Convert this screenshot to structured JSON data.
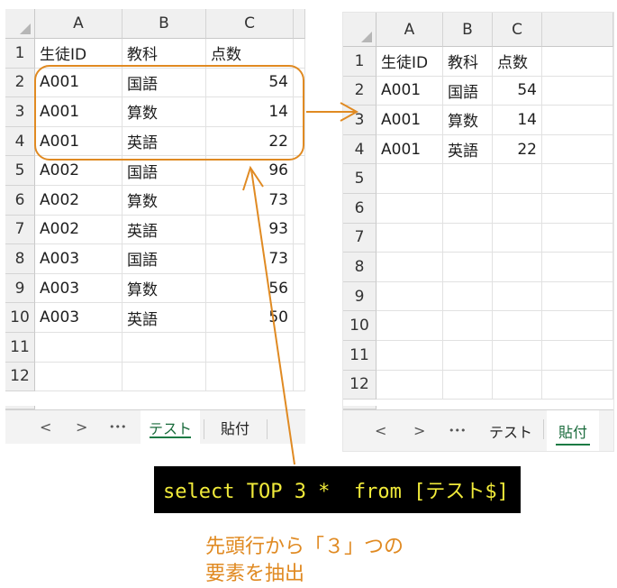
{
  "left_sheet": {
    "columns": [
      "A",
      "B",
      "C"
    ],
    "rows": [
      {
        "n": "1",
        "a": "生徒ID",
        "b": "教科",
        "c": "点数"
      },
      {
        "n": "2",
        "a": "A001",
        "b": "国語",
        "c": "54"
      },
      {
        "n": "3",
        "a": "A001",
        "b": "算数",
        "c": "14"
      },
      {
        "n": "4",
        "a": "A001",
        "b": "英語",
        "c": "22"
      },
      {
        "n": "5",
        "a": "A002",
        "b": "国語",
        "c": "96"
      },
      {
        "n": "6",
        "a": "A002",
        "b": "算数",
        "c": "73"
      },
      {
        "n": "7",
        "a": "A002",
        "b": "英語",
        "c": "93"
      },
      {
        "n": "8",
        "a": "A003",
        "b": "国語",
        "c": "73"
      },
      {
        "n": "9",
        "a": "A003",
        "b": "算数",
        "c": "56"
      },
      {
        "n": "10",
        "a": "A003",
        "b": "英語",
        "c": "50"
      },
      {
        "n": "11",
        "a": "",
        "b": "",
        "c": ""
      },
      {
        "n": "12",
        "a": "",
        "b": "",
        "c": ""
      }
    ],
    "tabs": {
      "prev": "<",
      "next": ">",
      "more": "•••",
      "sheets": [
        "テスト",
        "貼付"
      ],
      "active": "テスト"
    }
  },
  "right_sheet": {
    "columns": [
      "A",
      "B",
      "C"
    ],
    "rows": [
      {
        "n": "1",
        "a": "生徒ID",
        "b": "教科",
        "c": "点数"
      },
      {
        "n": "2",
        "a": "A001",
        "b": "国語",
        "c": "54"
      },
      {
        "n": "3",
        "a": "A001",
        "b": "算数",
        "c": "14"
      },
      {
        "n": "4",
        "a": "A001",
        "b": "英語",
        "c": "22"
      },
      {
        "n": "5",
        "a": "",
        "b": "",
        "c": ""
      },
      {
        "n": "6",
        "a": "",
        "b": "",
        "c": ""
      },
      {
        "n": "7",
        "a": "",
        "b": "",
        "c": ""
      },
      {
        "n": "8",
        "a": "",
        "b": "",
        "c": ""
      },
      {
        "n": "9",
        "a": "",
        "b": "",
        "c": ""
      },
      {
        "n": "10",
        "a": "",
        "b": "",
        "c": ""
      },
      {
        "n": "11",
        "a": "",
        "b": "",
        "c": ""
      },
      {
        "n": "12",
        "a": "",
        "b": "",
        "c": ""
      }
    ],
    "tabs": {
      "prev": "<",
      "next": ">",
      "more": "•••",
      "sheets": [
        "テスト",
        "貼付"
      ],
      "active": "貼付"
    }
  },
  "sql": "select TOP 3 *  from [テスト$]",
  "caption": {
    "line1": "先頭行から「３」つの",
    "line2": "要素を抽出"
  },
  "colors": {
    "annotation": "#e08a22",
    "sql_bg": "#000000",
    "sql_text": "#f0ea3a",
    "active_tab": "#1a7a44"
  }
}
